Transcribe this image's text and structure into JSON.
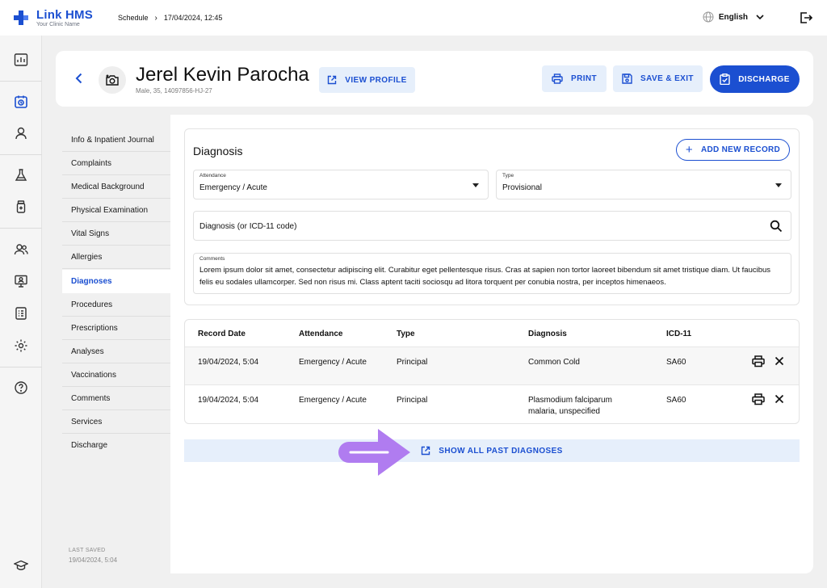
{
  "app": {
    "title": "Link HMS",
    "subtitle": "Your Clinic Name"
  },
  "breadcrumb": {
    "first": "Schedule",
    "separator": "›",
    "second": "17/04/2024, 12:45"
  },
  "language": "English",
  "patient": {
    "name": "Jerel Kevin Parocha",
    "meta": "Male, 35, 14097856-HJ-27"
  },
  "header_buttons": {
    "view_profile": "VIEW PROFILE",
    "print": "PRINT",
    "save_exit": "SAVE & EXIT",
    "discharge": "DISCHARGE"
  },
  "sidenav": {
    "items": [
      "Info & Inpatient Journal",
      "Complaints",
      "Medical Background",
      "Physical Examination",
      "Vital Signs",
      "Allergies",
      "Diagnoses",
      "Procedures",
      "Prescriptions",
      "Analyses",
      "Vaccinations",
      "Comments",
      "Services",
      "Discharge"
    ],
    "active": "Diagnoses",
    "last_saved_label": "LAST SAVED",
    "last_saved_value": "19/04/2024, 5:04"
  },
  "diagnosis_form": {
    "title": "Diagnosis",
    "add_button": "ADD NEW RECORD",
    "attendance_label": "Attendance",
    "attendance_value": "Emergency / Acute",
    "type_label": "Type",
    "type_value": "Provisional",
    "search_placeholder": "Diagnosis (or ICD-11 code)",
    "comments_label": "Comments",
    "comments_value": "Lorem ipsum dolor sit amet, consectetur adipiscing elit. Curabitur eget pellentesque risus. Cras at sapien non tortor laoreet bibendum sit amet tristique diam. Ut faucibus felis eu sodales ullamcorper. Sed non risus mi. Class aptent taciti sociosqu ad litora torquent per conubia nostra, per inceptos himenaeos."
  },
  "records_table": {
    "headers": {
      "date": "Record Date",
      "attendance": "Attendance",
      "type": "Type",
      "diagnosis": "Diagnosis",
      "icd": "ICD-11"
    },
    "rows": [
      {
        "date": "19/04/2024, 5:04",
        "attendance": "Emergency / Acute",
        "type": "Principal",
        "diagnosis": "Common Cold",
        "icd": "SA60"
      },
      {
        "date": "19/04/2024, 5:04",
        "attendance": "Emergency / Acute",
        "type": "Principal",
        "diagnosis": "Plasmodium falciparum malaria, unspecified",
        "icd": "SA60"
      }
    ]
  },
  "show_all_button": "SHOW ALL PAST DIAGNOSES",
  "colors": {
    "accent": "#1b4fd1",
    "accent_light": "#e6effb",
    "pointer": "#b07cf0"
  }
}
